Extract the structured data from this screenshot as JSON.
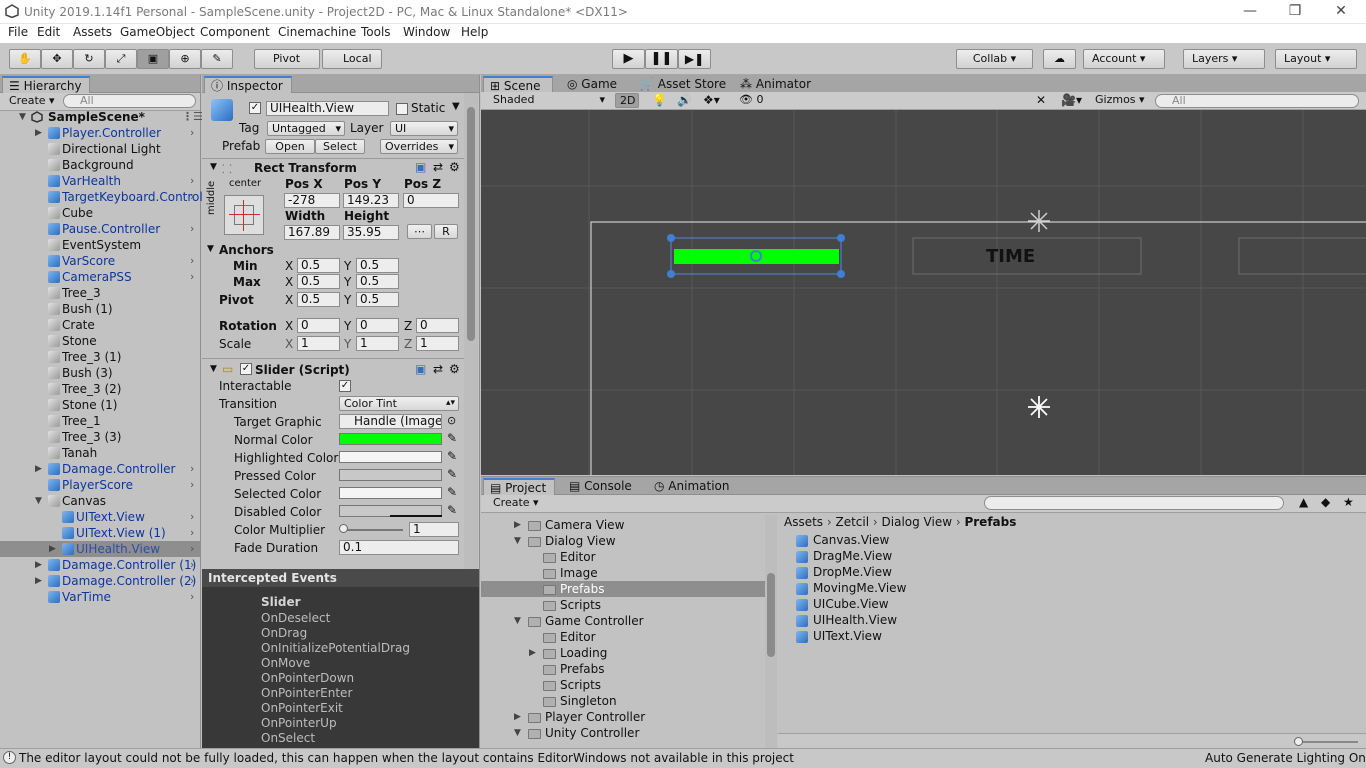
{
  "window": {
    "title": "Unity 2019.1.14f1 Personal - SampleScene.unity - Project2D - PC, Mac & Linux Standalone* <DX11>",
    "minimize": "—",
    "maximize": "❐",
    "close": "✕"
  },
  "menu": [
    "File",
    "Edit",
    "Assets",
    "GameObject",
    "Component",
    "Cinemachine",
    "Tools",
    "Window",
    "Help"
  ],
  "toolbar": {
    "pivot": "Pivot",
    "local": "Local",
    "collab": "Collab",
    "account": "Account",
    "layers": "Layers",
    "layout": "Layout"
  },
  "hierarchy": {
    "tab": "Hierarchy",
    "create": "Create",
    "search_placeholder": "All",
    "scene": "SampleScene*",
    "items": [
      {
        "label": "Player.Controller",
        "prefab": true,
        "indent": 1,
        "expand": true
      },
      {
        "label": "Directional Light",
        "prefab": false,
        "indent": 1
      },
      {
        "label": "Background",
        "prefab": false,
        "indent": 1
      },
      {
        "label": "VarHealth",
        "prefab": true,
        "indent": 1
      },
      {
        "label": "TargetKeyboard.Control",
        "prefab": true,
        "indent": 1
      },
      {
        "label": "Cube",
        "prefab": false,
        "indent": 1
      },
      {
        "label": "Pause.Controller",
        "prefab": true,
        "indent": 1
      },
      {
        "label": "EventSystem",
        "prefab": false,
        "indent": 1
      },
      {
        "label": "VarScore",
        "prefab": true,
        "indent": 1
      },
      {
        "label": "CameraPSS",
        "prefab": true,
        "indent": 1
      },
      {
        "label": "Tree_3",
        "prefab": false,
        "indent": 1
      },
      {
        "label": "Bush (1)",
        "prefab": false,
        "indent": 1
      },
      {
        "label": "Crate",
        "prefab": false,
        "indent": 1
      },
      {
        "label": "Stone",
        "prefab": false,
        "indent": 1
      },
      {
        "label": "Tree_3 (1)",
        "prefab": false,
        "indent": 1
      },
      {
        "label": "Bush (3)",
        "prefab": false,
        "indent": 1
      },
      {
        "label": "Tree_3 (2)",
        "prefab": false,
        "indent": 1
      },
      {
        "label": "Stone (1)",
        "prefab": false,
        "indent": 1
      },
      {
        "label": "Tree_1",
        "prefab": false,
        "indent": 1
      },
      {
        "label": "Tree_3 (3)",
        "prefab": false,
        "indent": 1
      },
      {
        "label": "Tanah",
        "prefab": false,
        "indent": 1
      },
      {
        "label": "Damage.Controller",
        "prefab": true,
        "indent": 1,
        "expand": true
      },
      {
        "label": "PlayerScore",
        "prefab": true,
        "indent": 1
      },
      {
        "label": "Canvas",
        "prefab": false,
        "indent": 1,
        "open": true
      },
      {
        "label": "UIText.View",
        "prefab": true,
        "indent": 2
      },
      {
        "label": "UIText.View (1)",
        "prefab": true,
        "indent": 2
      },
      {
        "label": "UIHealth.View",
        "prefab": true,
        "indent": 2,
        "selected": true,
        "expand": true
      },
      {
        "label": "Damage.Controller (1)",
        "prefab": true,
        "indent": 1,
        "expand": true
      },
      {
        "label": "Damage.Controller (2)",
        "prefab": true,
        "indent": 1,
        "expand": true
      },
      {
        "label": "VarTime",
        "prefab": true,
        "indent": 1
      }
    ]
  },
  "inspector": {
    "tab": "Inspector",
    "object_name": "UIHealth.View",
    "static_label": "Static",
    "tag_label": "Tag",
    "tag_value": "Untagged",
    "layer_label": "Layer",
    "layer_value": "UI",
    "prefab_label": "Prefab",
    "open": "Open",
    "select": "Select",
    "overrides": "Overrides",
    "rect": {
      "title": "Rect Transform",
      "anchor_h": "center",
      "anchor_v": "middle",
      "posx_label": "Pos X",
      "posy_label": "Pos Y",
      "posz_label": "Pos Z",
      "posx": "-278",
      "posy": "149.23",
      "posz": "0",
      "width_label": "Width",
      "height_label": "Height",
      "width": "167.89",
      "height": "35.95",
      "r": "R",
      "anchors": "Anchors",
      "min": "Min",
      "max": "Max",
      "pivot": "Pivot",
      "x": "X",
      "y": "Y",
      "z": "Z",
      "min_x": "0.5",
      "min_y": "0.5",
      "max_x": "0.5",
      "max_y": "0.5",
      "pivot_x": "0.5",
      "pivot_y": "0.5",
      "rotation": "Rotation",
      "rot_x": "0",
      "rot_y": "0",
      "rot_z": "0",
      "scale": "Scale",
      "scale_x": "1",
      "scale_y": "1",
      "scale_z": "1"
    },
    "slider": {
      "title": "Slider (Script)",
      "interactable": "Interactable",
      "transition": "Transition",
      "transition_value": "Color Tint",
      "target_graphic": "Target Graphic",
      "target_value": "Handle (Image",
      "normal": "Normal Color",
      "highlighted": "Highlighted Color",
      "pressed": "Pressed Color",
      "selected": "Selected Color",
      "disabled": "Disabled Color",
      "multiplier": "Color Multiplier",
      "multiplier_value": "1",
      "fade": "Fade Duration",
      "fade_value": "0.1",
      "normal_color": "#00ff00",
      "highlighted_color": "#f5f5f5",
      "pressed_color": "#c8c8c8",
      "selected_color": "#f5f5f5",
      "disabled_color": "#c8c8c8"
    },
    "events": {
      "title": "Intercepted Events",
      "header": "Slider",
      "items": [
        "OnDeselect",
        "OnDrag",
        "OnInitializePotentialDrag",
        "OnMove",
        "OnPointerDown",
        "OnPointerEnter",
        "OnPointerExit",
        "OnPointerUp",
        "OnSelect"
      ]
    }
  },
  "scene": {
    "tabs": [
      "Scene",
      "Game",
      "Asset Store",
      "Animator"
    ],
    "shaded": "Shaded",
    "mode2d": "2D",
    "fx_count": "0",
    "gizmos": "Gizmos",
    "search_placeholder": "All",
    "time_label": "TIME",
    "bg_color": "#474747",
    "health_color": "#00ff00"
  },
  "project": {
    "tabs": [
      "Project",
      "Console",
      "Animation"
    ],
    "create": "Create",
    "tree": [
      {
        "label": "Camera View",
        "depth": 1,
        "arrow": "▶"
      },
      {
        "label": "Dialog View",
        "depth": 1,
        "arrow": "▼"
      },
      {
        "label": "Editor",
        "depth": 2,
        "arrow": ""
      },
      {
        "label": "Image",
        "depth": 2,
        "arrow": ""
      },
      {
        "label": "Prefabs",
        "depth": 2,
        "arrow": "",
        "selected": true
      },
      {
        "label": "Scripts",
        "depth": 2,
        "arrow": ""
      },
      {
        "label": "Game Controller",
        "depth": 1,
        "arrow": "▼"
      },
      {
        "label": "Editor",
        "depth": 2,
        "arrow": ""
      },
      {
        "label": "Loading",
        "depth": 2,
        "arrow": "▶"
      },
      {
        "label": "Prefabs",
        "depth": 2,
        "arrow": ""
      },
      {
        "label": "Scripts",
        "depth": 2,
        "arrow": ""
      },
      {
        "label": "Singleton",
        "depth": 2,
        "arrow": ""
      },
      {
        "label": "Player Controller",
        "depth": 1,
        "arrow": "▶"
      },
      {
        "label": "Unity Controller",
        "depth": 1,
        "arrow": "▼"
      }
    ],
    "breadcrumb": [
      "Assets",
      "Zetcil",
      "Dialog View",
      "Prefabs"
    ],
    "assets": [
      "Canvas.View",
      "DragMe.View",
      "DropMe.View",
      "MovingMe.View",
      "UICube.View",
      "UIHealth.View",
      "UIText.View"
    ]
  },
  "status": {
    "message": "The editor layout could not be fully loaded, this can happen when the layout contains EditorWindows not available in this project",
    "right": "Auto Generate Lighting On"
  }
}
